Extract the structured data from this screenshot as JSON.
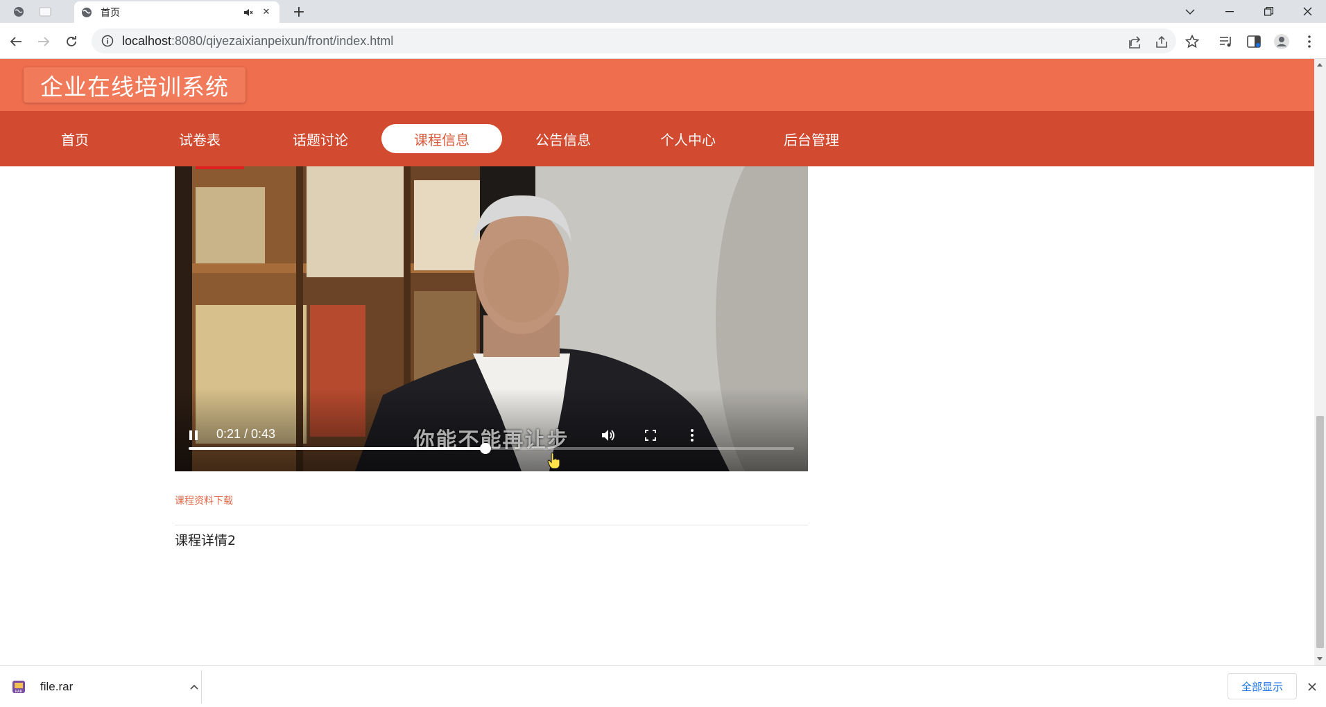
{
  "browser": {
    "tab_title": "首页",
    "url_host": "localhost",
    "url_rest": ":8080/qiyezaixianpeixun/front/index.html"
  },
  "site": {
    "title": "企业在线培训系统",
    "nav": [
      "首页",
      "试卷表",
      "话题讨论",
      "课程信息",
      "公告信息",
      "个人中心",
      "后台管理"
    ],
    "active_nav": "课程信息",
    "accent_color": "#ef6e4e",
    "nav_color": "#d24a30"
  },
  "video": {
    "time": "0:21 / 0:43",
    "progress": 0.49,
    "subtitle": "你能不能再让步",
    "state": "playing"
  },
  "course": {
    "download_label": "课程资料下载",
    "detail": "课程详情2"
  },
  "downloads": {
    "file_name": "file.rar",
    "show_all": "全部显示"
  }
}
